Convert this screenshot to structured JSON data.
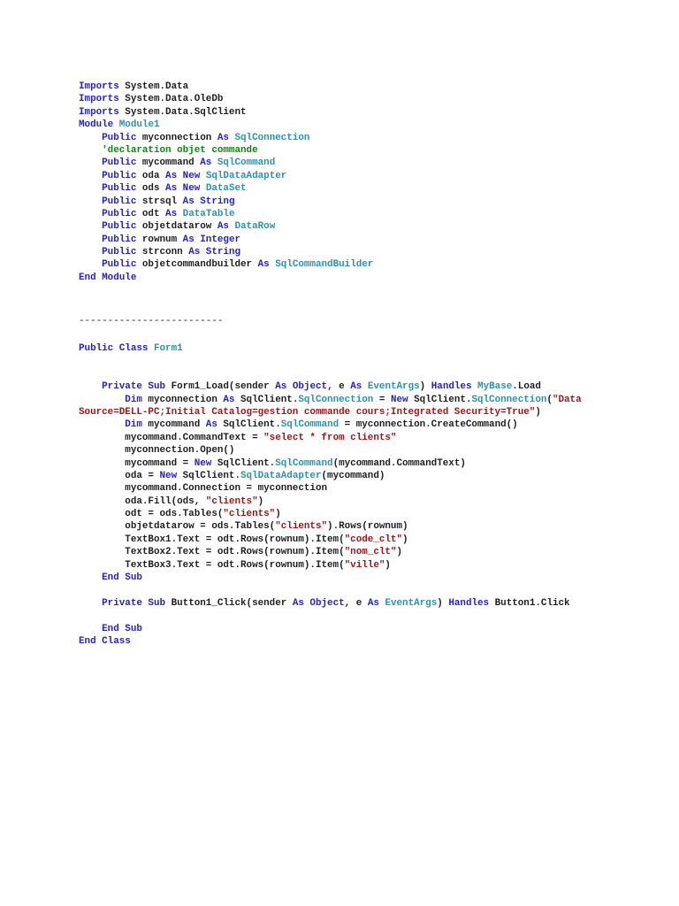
{
  "module_block": {
    "lines": [
      [
        {
          "t": "kw",
          "s": "Imports"
        },
        {
          "t": "pl",
          "s": " System.Data"
        }
      ],
      [
        {
          "t": "kw",
          "s": "Imports"
        },
        {
          "t": "pl",
          "s": " System.Data.OleDb"
        }
      ],
      [
        {
          "t": "kw",
          "s": "Imports"
        },
        {
          "t": "pl",
          "s": " System.Data.SqlClient"
        }
      ],
      [
        {
          "t": "kw",
          "s": "Module"
        },
        {
          "t": "pl",
          "s": " "
        },
        {
          "t": "ty",
          "s": "Module1"
        }
      ],
      [
        {
          "t": "kw",
          "s": "    Public"
        },
        {
          "t": "pl",
          "s": " myconnection "
        },
        {
          "t": "kw",
          "s": "As"
        },
        {
          "t": "pl",
          "s": " "
        },
        {
          "t": "ty",
          "s": "SqlConnection"
        }
      ],
      [
        {
          "t": "cm",
          "s": "    'declaration objet commande"
        }
      ],
      [
        {
          "t": "kw",
          "s": "    Public"
        },
        {
          "t": "pl",
          "s": " mycommand "
        },
        {
          "t": "kw",
          "s": "As"
        },
        {
          "t": "pl",
          "s": " "
        },
        {
          "t": "ty",
          "s": "SqlCommand"
        }
      ],
      [
        {
          "t": "kw",
          "s": "    Public"
        },
        {
          "t": "pl",
          "s": " oda "
        },
        {
          "t": "kw",
          "s": "As New"
        },
        {
          "t": "pl",
          "s": " "
        },
        {
          "t": "ty",
          "s": "SqlDataAdapter"
        }
      ],
      [
        {
          "t": "kw",
          "s": "    Public"
        },
        {
          "t": "pl",
          "s": " ods "
        },
        {
          "t": "kw",
          "s": "As New"
        },
        {
          "t": "pl",
          "s": " "
        },
        {
          "t": "ty",
          "s": "DataSet"
        }
      ],
      [
        {
          "t": "kw",
          "s": "    Public"
        },
        {
          "t": "pl",
          "s": " strsql "
        },
        {
          "t": "kw",
          "s": "As String"
        }
      ],
      [
        {
          "t": "kw",
          "s": "    Public"
        },
        {
          "t": "pl",
          "s": " odt "
        },
        {
          "t": "kw",
          "s": "As"
        },
        {
          "t": "pl",
          "s": " "
        },
        {
          "t": "ty",
          "s": "DataTable"
        }
      ],
      [
        {
          "t": "kw",
          "s": "    Public"
        },
        {
          "t": "pl",
          "s": " objetdatarow "
        },
        {
          "t": "kw",
          "s": "As"
        },
        {
          "t": "pl",
          "s": " "
        },
        {
          "t": "ty",
          "s": "DataRow"
        }
      ],
      [
        {
          "t": "kw",
          "s": "    Public"
        },
        {
          "t": "pl",
          "s": " rownum "
        },
        {
          "t": "kw",
          "s": "As Integer"
        }
      ],
      [
        {
          "t": "kw",
          "s": "    Public"
        },
        {
          "t": "pl",
          "s": " strconn "
        },
        {
          "t": "kw",
          "s": "As String"
        }
      ],
      [
        {
          "t": "kw",
          "s": "    Public"
        },
        {
          "t": "pl",
          "s": " objetcommandbuilder "
        },
        {
          "t": "kw",
          "s": "As"
        },
        {
          "t": "pl",
          "s": " "
        },
        {
          "t": "ty",
          "s": "SqlCommandBuilder"
        }
      ],
      [
        {
          "t": "kw",
          "s": "End Module"
        }
      ]
    ]
  },
  "separator": {
    "lines": [
      [
        {
          "t": "pl",
          "s": "-------------------------"
        }
      ]
    ]
  },
  "class_block": {
    "lines": [
      [
        {
          "t": "kw",
          "s": "Public Class"
        },
        {
          "t": "pl",
          "s": " "
        },
        {
          "t": "ty",
          "s": "Form1"
        }
      ],
      [],
      [],
      [
        {
          "t": "kw",
          "s": "    Private Sub"
        },
        {
          "t": "pl",
          "s": " Form1_Load(sender "
        },
        {
          "t": "kw",
          "s": "As Object"
        },
        {
          "t": "pl",
          "s": ", e "
        },
        {
          "t": "kw",
          "s": "As"
        },
        {
          "t": "pl",
          "s": " "
        },
        {
          "t": "ty",
          "s": "EventArgs"
        },
        {
          "t": "pl",
          "s": ") "
        },
        {
          "t": "kw",
          "s": "Handles"
        },
        {
          "t": "pl",
          "s": " "
        },
        {
          "t": "ty",
          "s": "MyBase"
        },
        {
          "t": "pl",
          "s": ".Load"
        }
      ],
      [
        {
          "t": "kw",
          "s": "        Dim"
        },
        {
          "t": "pl",
          "s": " myconnection "
        },
        {
          "t": "kw",
          "s": "As"
        },
        {
          "t": "pl",
          "s": " SqlClient."
        },
        {
          "t": "ty",
          "s": "SqlConnection"
        },
        {
          "t": "pl",
          "s": " = "
        },
        {
          "t": "kw",
          "s": "New"
        },
        {
          "t": "pl",
          "s": " SqlClient."
        },
        {
          "t": "ty",
          "s": "SqlConnection"
        },
        {
          "t": "pl",
          "s": "("
        },
        {
          "t": "st",
          "s": "\"Data"
        }
      ],
      [
        {
          "t": "st",
          "s": "Source=DELL-PC;Initial Catalog=gestion commande cours;Integrated Security=True\""
        },
        {
          "t": "pl",
          "s": ")"
        }
      ],
      [
        {
          "t": "kw",
          "s": "        Dim"
        },
        {
          "t": "pl",
          "s": " mycommand "
        },
        {
          "t": "kw",
          "s": "As"
        },
        {
          "t": "pl",
          "s": " SqlClient."
        },
        {
          "t": "ty",
          "s": "SqlCommand"
        },
        {
          "t": "pl",
          "s": " = myconnection.CreateCommand()"
        }
      ],
      [
        {
          "t": "pl",
          "s": "        mycommand.CommandText = "
        },
        {
          "t": "st",
          "s": "\"select * from clients\""
        }
      ],
      [
        {
          "t": "pl",
          "s": "        myconnection.Open()"
        }
      ],
      [
        {
          "t": "pl",
          "s": "        mycommand = "
        },
        {
          "t": "kw",
          "s": "New"
        },
        {
          "t": "pl",
          "s": " SqlClient."
        },
        {
          "t": "ty",
          "s": "SqlCommand"
        },
        {
          "t": "pl",
          "s": "(mycommand.CommandText)"
        }
      ],
      [
        {
          "t": "pl",
          "s": "        oda = "
        },
        {
          "t": "kw",
          "s": "New"
        },
        {
          "t": "pl",
          "s": " SqlClient."
        },
        {
          "t": "ty",
          "s": "SqlDataAdapter"
        },
        {
          "t": "pl",
          "s": "(mycommand)"
        }
      ],
      [
        {
          "t": "pl",
          "s": "        mycommand.Connection = myconnection"
        }
      ],
      [
        {
          "t": "pl",
          "s": "        oda.Fill(ods, "
        },
        {
          "t": "st",
          "s": "\"clients\""
        },
        {
          "t": "pl",
          "s": ")"
        }
      ],
      [
        {
          "t": "pl",
          "s": "        odt = ods.Tables("
        },
        {
          "t": "st",
          "s": "\"clients\""
        },
        {
          "t": "pl",
          "s": ")"
        }
      ],
      [
        {
          "t": "pl",
          "s": "        objetdatarow = ods.Tables("
        },
        {
          "t": "st",
          "s": "\"clients\""
        },
        {
          "t": "pl",
          "s": ").Rows(rownum)"
        }
      ],
      [
        {
          "t": "pl",
          "s": "        TextBox1.Text = odt.Rows(rownum).Item("
        },
        {
          "t": "st",
          "s": "\"code_clt\""
        },
        {
          "t": "pl",
          "s": ")"
        }
      ],
      [
        {
          "t": "pl",
          "s": "        TextBox2.Text = odt.Rows(rownum).Item("
        },
        {
          "t": "st",
          "s": "\"nom_clt\""
        },
        {
          "t": "pl",
          "s": ")"
        }
      ],
      [
        {
          "t": "pl",
          "s": "        TextBox3.Text = odt.Rows(rownum).Item("
        },
        {
          "t": "st",
          "s": "\"ville\""
        },
        {
          "t": "pl",
          "s": ")"
        }
      ],
      [
        {
          "t": "kw",
          "s": "    End Sub"
        }
      ],
      [],
      [
        {
          "t": "kw",
          "s": "    Private Sub"
        },
        {
          "t": "pl",
          "s": " Button1_Click(sender "
        },
        {
          "t": "kw",
          "s": "As Object"
        },
        {
          "t": "pl",
          "s": ", e "
        },
        {
          "t": "kw",
          "s": "As"
        },
        {
          "t": "pl",
          "s": " "
        },
        {
          "t": "ty",
          "s": "EventArgs"
        },
        {
          "t": "pl",
          "s": ") "
        },
        {
          "t": "kw",
          "s": "Handles"
        },
        {
          "t": "pl",
          "s": " Button1.Click"
        }
      ],
      [],
      [
        {
          "t": "kw",
          "s": "    End Sub"
        }
      ],
      [
        {
          "t": "kw",
          "s": "End Class"
        }
      ]
    ]
  }
}
